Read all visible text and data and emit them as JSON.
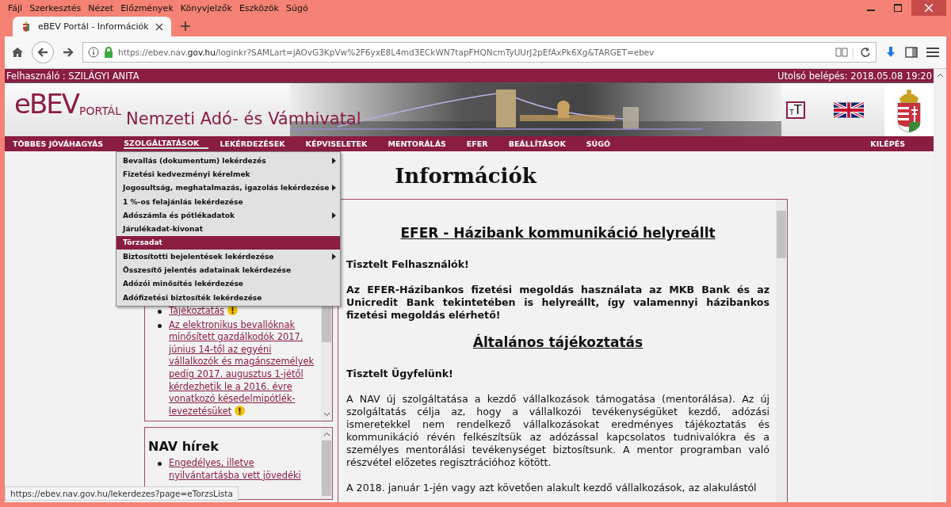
{
  "browser": {
    "menu": [
      "Fájl",
      "Szerkesztés",
      "Nézet",
      "Előzmények",
      "Könyvjelzők",
      "Eszközök",
      "Súgó"
    ],
    "tabs": [
      {
        "title": "eBEV Portál - Információk",
        "selected": true
      }
    ],
    "url_host": "https://ebev.nav.",
    "url_domain": "gov.hu",
    "url_rest": "/loginkr?SAMLart=jAOvG3KpVw%2F6yxE8L4md3ECkWN7tapFHQNcmTyUUrJ2pEfAxPk6Xg&TARGET=ebev",
    "status_url": "https://ebev.nav.gov.hu/lekerdezes?page=eTorzsLista"
  },
  "page": {
    "user_label": "Felhasználó : SZILÁGYI ANITA",
    "last_login": "Utolsó belépés: 2018.05.08 19:20",
    "logo_main": "eBEV",
    "logo_sub": "PORTÁL",
    "agency": "Nemzeti Adó- és Vámhivatal",
    "text_size_small": "T",
    "text_size_large": "T",
    "nav": [
      {
        "label": "TÖBBES JÓVÁHAGYÁS",
        "selected": false
      },
      {
        "label": "SZOLGÁLTATÁSOK",
        "selected": true
      },
      {
        "label": "LEKÉRDEZÉSEK",
        "selected": false
      },
      {
        "label": "KÉPVISELETEK",
        "selected": false
      },
      {
        "label": "MENTORÁLÁS",
        "selected": false
      },
      {
        "label": "EFER",
        "selected": false
      },
      {
        "label": "BEÁLLÍTÁSOK",
        "selected": false
      },
      {
        "label": "SÚGÓ",
        "selected": false
      }
    ],
    "logout": "KILÉPÉS",
    "dropdown": [
      {
        "label": "Bevallás (dokumentum) lekérdezés",
        "submenu": true,
        "selected": false
      },
      {
        "label": "Fizetési kedvezményi kérelmek",
        "submenu": false,
        "selected": false
      },
      {
        "label": "Jogosultság, meghatalmazás, igazolás lekérdezése",
        "submenu": true,
        "selected": false
      },
      {
        "label": "1 %-os felajánlás lekérdezése",
        "submenu": false,
        "selected": false
      },
      {
        "label": "Adószámla és pótlékadatok",
        "submenu": true,
        "selected": false
      },
      {
        "label": "Járulékadat-kivonat",
        "submenu": false,
        "selected": false
      },
      {
        "label": "Törzsadat",
        "submenu": false,
        "selected": true
      },
      {
        "label": "Biztosítotti bejelentések lekérdezése",
        "submenu": true,
        "selected": false
      },
      {
        "label": "Összesítő jelentés adatainak lekérdezése",
        "submenu": false,
        "selected": false
      },
      {
        "label": "Adózói minősítés lekérdezése",
        "submenu": false,
        "selected": false
      },
      {
        "label": "Adófizetési biztosíték lekérdezése",
        "submenu": false,
        "selected": false
      }
    ],
    "title": "Információk",
    "side_boxes": [
      {
        "items": [
          {
            "text": "Tájékoztatás",
            "alert": true
          },
          {
            "text": "Az elektronikus bevallóknak minősített gazdálkodók 2017. június 14-től az egyéni vállalkozók és magánszemélyek pedig 2017. augusztus 1-jétől kérdezhetik le a 2016. évre vonatkozó késedelmipótlék-levezetésüket",
            "alert": true
          }
        ]
      },
      {
        "title": "NAV hírek",
        "items": [
          {
            "text": "Engedélyes, illetve nyilvántartásba vett jövedéki",
            "alert": false
          }
        ]
      }
    ],
    "main": [
      {
        "kind": "heading",
        "text": "EFER - Házibank kommunikáció helyreállt"
      },
      {
        "kind": "bold",
        "text": "Tisztelt Felhasználók!"
      },
      {
        "kind": "bold",
        "text": "Az EFER-Házibankos fizetési megoldás használata az MKB Bank és az Unicredit Bank tekintetében is helyreállt, így valamennyi házibankos fizetési megoldás elérhető!"
      },
      {
        "kind": "heading",
        "text": "Általános tájékoztatás"
      },
      {
        "kind": "bold",
        "text": "Tisztelt Ügyfelünk!"
      },
      {
        "kind": "text",
        "text": "A NAV új szolgáltatása a kezdő vállalkozások támogatása (mentorálása). Az új szolgáltatás célja az, hogy a vállalkozói tevékenységüket kezdő, adózási ismeretekkel nem rendelkező vállalkozásokat eredményes tájékoztatás és kommunikáció révén felkészítsük az adózással kapcsolatos tudnivalókra és a személyes mentorálási tevékenységet biztosítsunk. A mentor programban való részvétel előzetes regisztrációhoz kötött."
      },
      {
        "kind": "text",
        "text": "A 2018. január 1-jén vagy azt követően alakult kezdő vállalkozások, az alakulástól"
      }
    ]
  }
}
